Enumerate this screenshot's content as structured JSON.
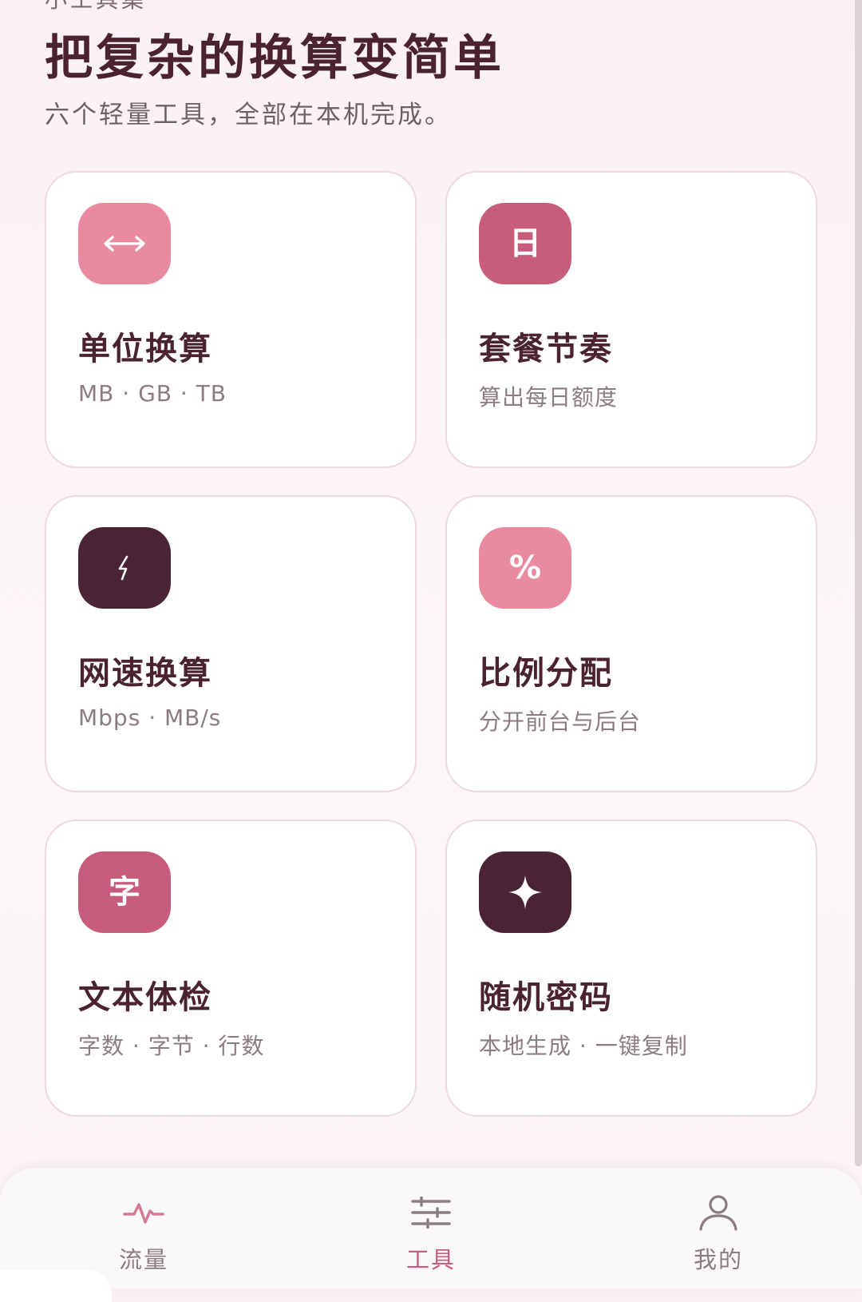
{
  "header": {
    "eyebrow": "小工具集",
    "title": "把复杂的换算变简单",
    "subtitle": "六个轻量工具，全部在本机完成。"
  },
  "tools": [
    {
      "title": "单位换算",
      "subtitle": "MB · GB · TB",
      "icon": "arrows-horizontal-icon",
      "glyph": "",
      "color": "#e88ba0"
    },
    {
      "title": "套餐节奏",
      "subtitle": "算出每日额度",
      "icon": "calendar-day-icon",
      "glyph": "日",
      "color": "#c75d7b"
    },
    {
      "title": "网速换算",
      "subtitle": "Mbps · MB/s",
      "icon": "lightning-icon",
      "glyph": "",
      "color": "#4a2335"
    },
    {
      "title": "比例分配",
      "subtitle": "分开前台与后台",
      "icon": "percent-icon",
      "glyph": "%",
      "color": "#e88ba0"
    },
    {
      "title": "文本体检",
      "subtitle": "字数 · 字节 · 行数",
      "icon": "character-icon",
      "glyph": "字",
      "color": "#c75d7b"
    },
    {
      "title": "随机密码",
      "subtitle": "本地生成 · 一键复制",
      "icon": "sparkle-icon",
      "glyph": "",
      "color": "#4a2335"
    }
  ],
  "bottom_nav": {
    "items": [
      {
        "label": "流量",
        "icon": "pulse-icon",
        "active": false
      },
      {
        "label": "工具",
        "icon": "sliders-icon",
        "active": true
      },
      {
        "label": "我的",
        "icon": "person-icon",
        "active": false
      }
    ]
  },
  "colors": {
    "accent": "#c75d7b",
    "accent_light": "#e88ba0",
    "dark": "#4a2335",
    "text_primary": "#4a2232",
    "text_secondary": "#8a7c82"
  }
}
